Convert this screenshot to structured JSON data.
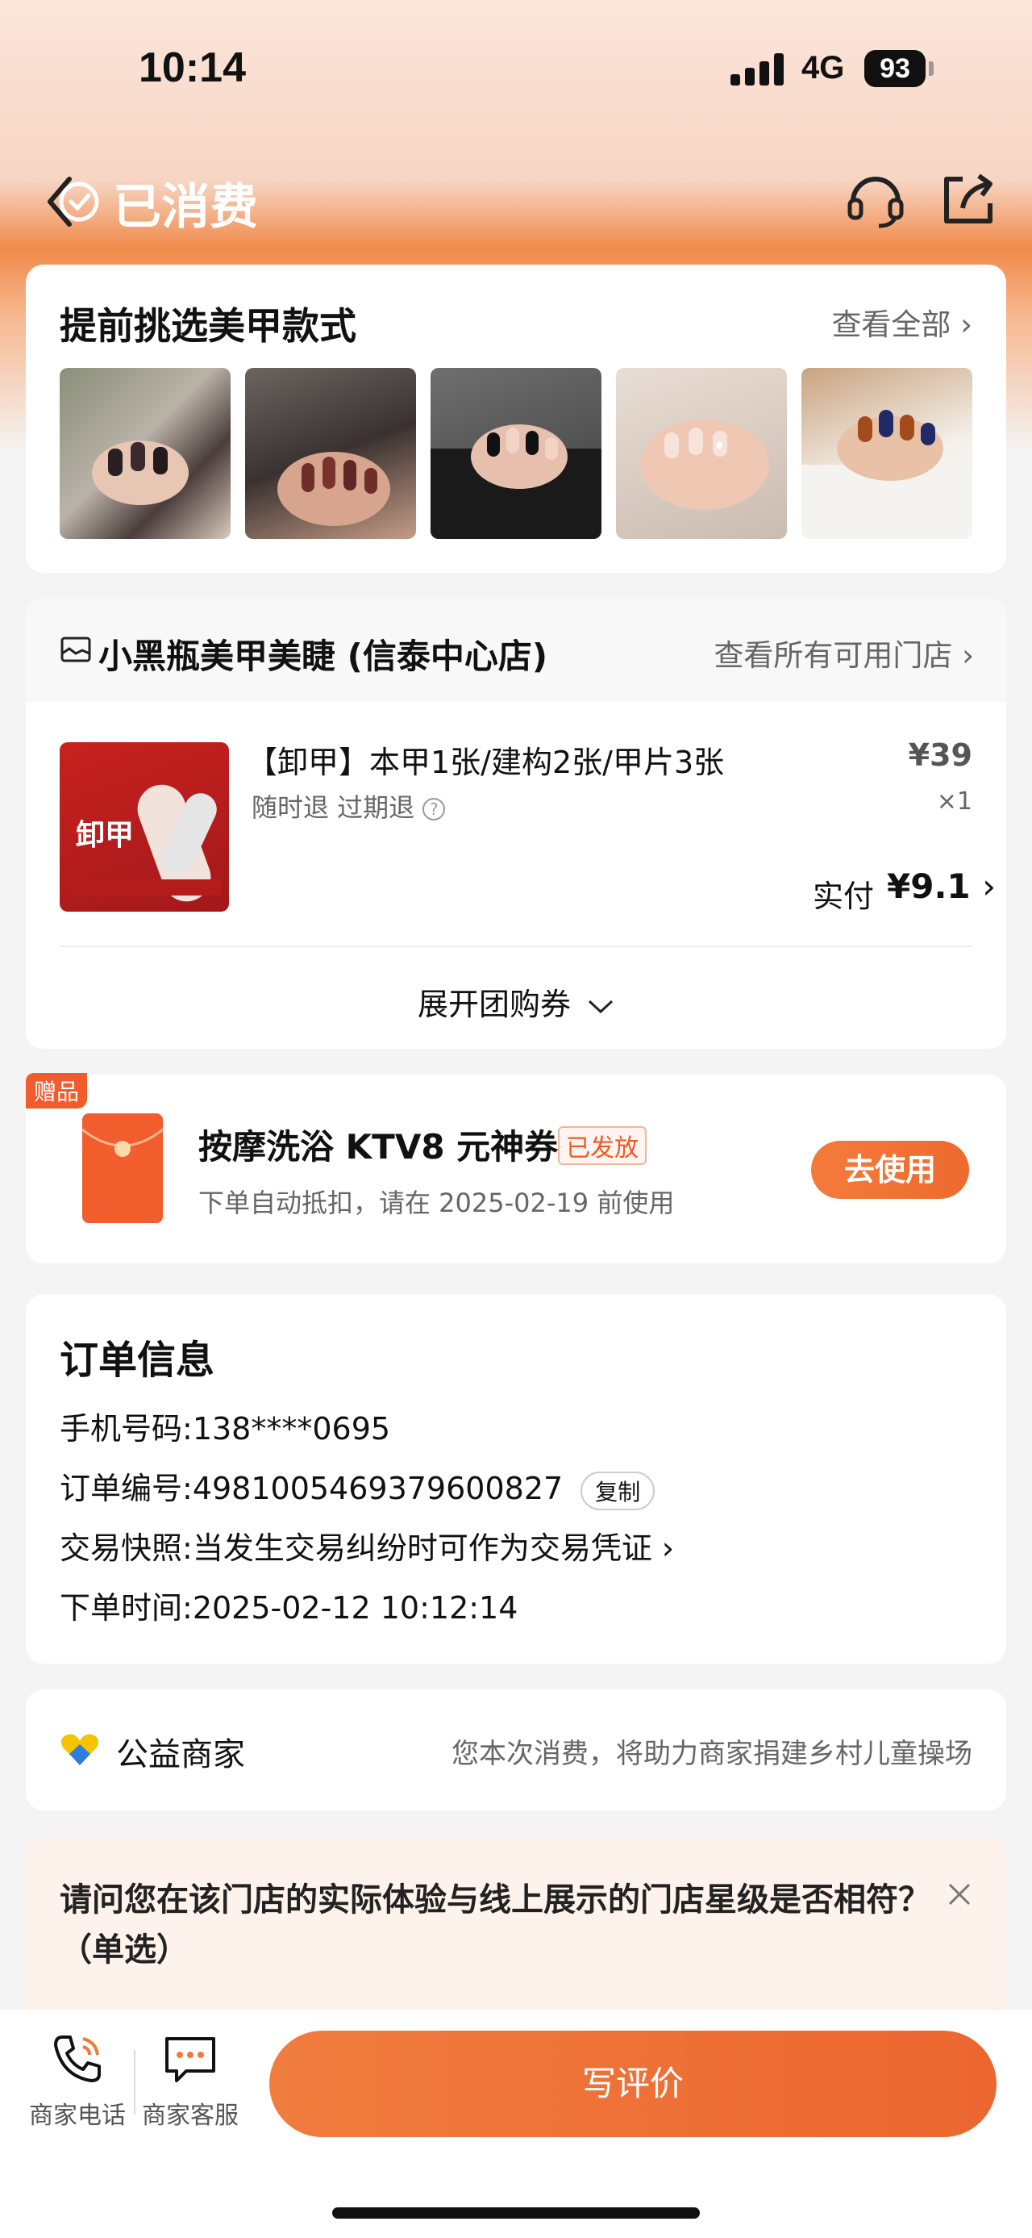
{
  "status": {
    "time": "10:14",
    "network": "4G",
    "battery": "93"
  },
  "nav": {
    "title": "已消费"
  },
  "styles": {
    "title": "提前挑选美甲款式",
    "view_all": "查看全部",
    "thumbs": [
      "nail-photo-1",
      "nail-photo-2",
      "nail-photo-3",
      "nail-photo-4",
      "nail-photo-5"
    ]
  },
  "store": {
    "name": "小黑瓶美甲美睫 (信泰中心店)",
    "view_stores": "查看所有可用门店",
    "deal": {
      "title": "【卸甲】本甲1张/建构2张/甲片3张",
      "tags": "随时退 过期退",
      "price": "¥39",
      "qty": "×1",
      "paid_label": "实付",
      "paid_value": "¥9.1",
      "image_text": "卸甲"
    },
    "expand": "展开团购券"
  },
  "gift": {
    "badge": "赠品",
    "title": "按摩洗浴 KTV8 元神券",
    "status": "已发放",
    "desc": "下单自动抵扣，请在 2025-02-19 前使用",
    "button": "去使用"
  },
  "order": {
    "title": "订单信息",
    "phone_label": "手机号码:",
    "phone": "138****0695",
    "id_label": "订单编号:",
    "id": "4981005469379600827",
    "copy": "复制",
    "snapshot_label": "交易快照:",
    "snapshot": "当发生交易纠纷时可作为交易凭证",
    "time_label": "下单时间:",
    "time": "2025-02-12 10:12:14"
  },
  "charity": {
    "label": "公益商家",
    "desc": "您本次消费，将助力商家捐建乡村儿童操场"
  },
  "survey": {
    "question": "请问您在该门店的实际体验与线上展示的门店星级是否相符？（单选）"
  },
  "bottom": {
    "phone": "商家电话",
    "service": "商家客服",
    "review": "写评价"
  },
  "colors": {
    "accent": "#ee6a2e",
    "page_bg": "#f4f4f4"
  }
}
